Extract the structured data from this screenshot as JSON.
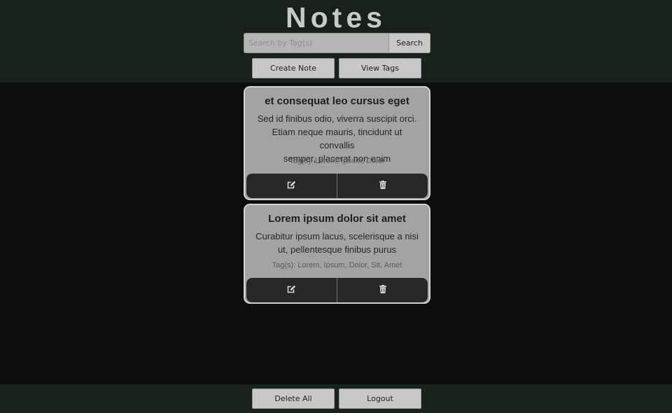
{
  "header": {
    "title": "Notes",
    "search": {
      "placeholder": "Search by Tag(s)",
      "value": "",
      "button_label": "Search"
    },
    "create_label": "Create Note",
    "view_tags_label": "View Tags"
  },
  "notes": [
    {
      "title": "et consequat leo cursus eget",
      "body_lines": [
        "Sed id finibus odio, viverra suscipit orci.",
        "Etiam neque mauris, tincidunt ut convallis",
        "semper, placerat non enim"
      ],
      "tags": "Tag(s): Lorem, Ipsum, Dolor",
      "edit_icon": "edit-icon",
      "delete_icon": "trash-icon"
    },
    {
      "title": "Lorem ipsum dolor sit amet",
      "body_lines": [
        "Curabitur ipsum lacus, scelerisque a nisi",
        "ut, pellentesque finibus purus"
      ],
      "tags": "Tag(s): Lorem, Ipsum, Dolor, Sit, Amet",
      "edit_icon": "edit-icon",
      "delete_icon": "trash-icon"
    }
  ],
  "footer": {
    "delete_all_label": "Delete All",
    "logout_label": "Logout"
  },
  "colors": {
    "header_bg": "#17231a",
    "page_bg": "#0d0d0d",
    "card_bg": "#a3a3a3",
    "action_bg": "#282828"
  }
}
